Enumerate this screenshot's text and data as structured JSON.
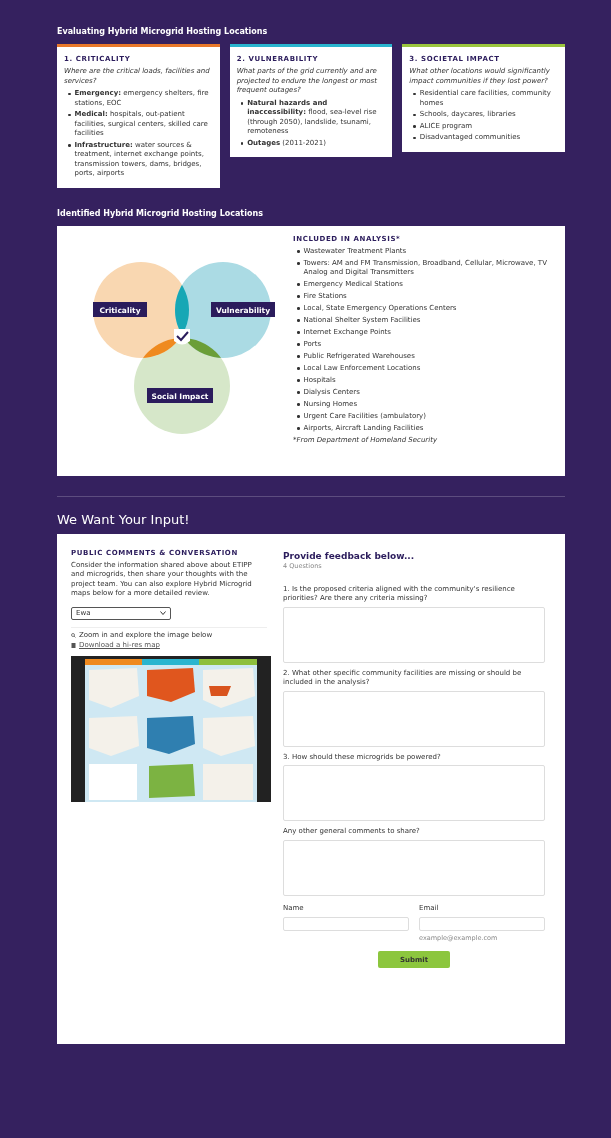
{
  "criteria": {
    "heading": "Evaluating Hybrid Microgrid Hosting Locations",
    "cards": [
      {
        "title": "1. CRITICALITY",
        "color": "#e8782a",
        "question": "Where are the critical loads, facilities and services?",
        "items": [
          "**Emergency:** emergency shelters, fire stations, EOC",
          "**Medical:** hospitals, out-patient facilities, surgical centers, skilled care facilities",
          "**Infrastructure:** water sources & treatment, internet exchange points, transmission towers, dams, bridges, ports, airports"
        ]
      },
      {
        "title": "2. VULNERABILITY",
        "color": "#2ab5cf",
        "question": "What parts of the grid currently and are projected to endure the longest or most frequent outages?",
        "items": [
          "**Natural hazards and inaccessibility:** flood, sea-level rise (through 2050), landslide, tsunami, remoteness",
          "**Outages** (2011-2021)"
        ]
      },
      {
        "title": "3. SOCIETAL IMPACT",
        "color": "#9bc53d",
        "question": "What other locations would significantly impact communities if they lost power?",
        "items": [
          "Residential care facilities, community homes",
          "Schools, daycares, libraries",
          "ALICE program",
          "Disadvantaged communities"
        ]
      }
    ]
  },
  "identified": {
    "heading": "Identified Hybrid Microgrid Hosting Locations",
    "venn_labels": [
      "Criticality",
      "Vulnerability",
      "Social Impact"
    ],
    "analysis_title": "INCLUDED IN ANALYSIS*",
    "analysis_items": [
      "Wastewater Treatment Plants",
      "Towers: AM and FM Transmission, Broadband, Cellular, Microwave, TV Analog and Digital Transmitters",
      "Emergency Medical Stations",
      "Fire Stations",
      "Local, State Emergency Operations Centers",
      "National Shelter System Facilities",
      "Internet Exchange Points",
      "Ports",
      "Public Refrigerated Warehouses",
      "Local Law Enforcement Locations",
      "Hospitals",
      "Dialysis Centers",
      "Nursing Homes",
      "Urgent Care Facilities (ambulatory)",
      "Airports, Aircraft Landing Facilities"
    ],
    "footnote": "*From Department of Homeland Security"
  },
  "input": {
    "heading": "We Want Your Input!",
    "comments": {
      "title": "PUBLIC COMMENTS & CONVERSATION",
      "text": "Consider the information shared above about ETIPP and microgrids, then share your thoughts with the project team. You can also explore Hybrid Microgrid maps below for a more detailed review.",
      "select": "Ewa",
      "zoom_hint": "Zoom in and explore the image below",
      "download_link": "Download a hi-res map"
    },
    "form": {
      "title": "Provide feedback below...",
      "count": "4 Questions",
      "questions": [
        "1. Is the proposed criteria aligned with the community's resilience priorities? Are there any criteria missing?",
        "2. What other specific community facilities are missing or should be included in the analysis?",
        "3. How should these microgrids be powered?",
        "Any other general comments to share?"
      ],
      "name_label": "Name",
      "email_label": "Email",
      "email_hint": "example@example.com",
      "submit": "Submit"
    }
  }
}
